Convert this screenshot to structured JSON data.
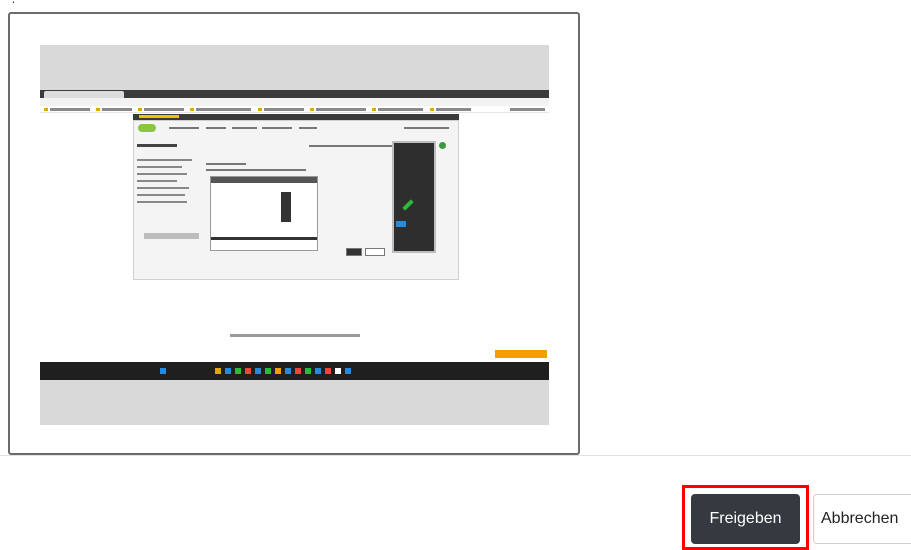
{
  "dialog": {
    "heading_partial": "· . · · · · · · · ·",
    "preview": {
      "description": "Embedded screenshot preview"
    }
  },
  "footer": {
    "share_label": "Freigeben",
    "cancel_label": "Abbrechen"
  },
  "colors": {
    "share_bg": "#343a40",
    "highlight": "#ff0000",
    "preview_border": "#6b6b6b",
    "preview_gray": "#d9d9d9"
  }
}
